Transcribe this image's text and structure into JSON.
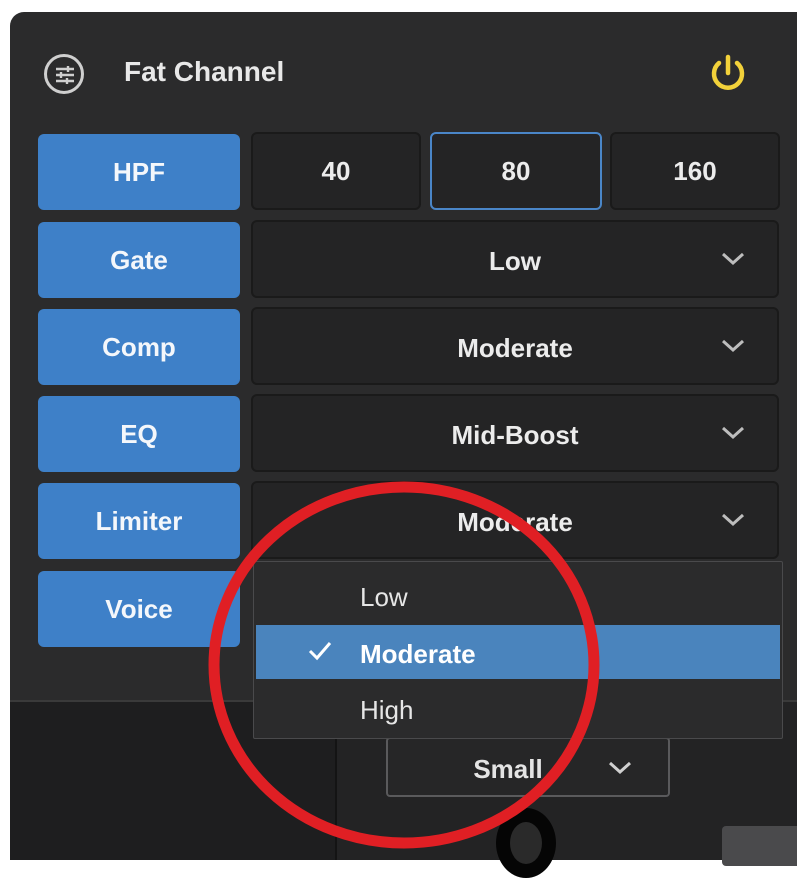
{
  "window": {
    "title": "Fat Channel"
  },
  "icons": {
    "settings": "sliders-icon",
    "power": "power-icon",
    "chevron": "chevron-down-icon",
    "check": "checkmark-icon"
  },
  "colors": {
    "accent_blue": "#3e80c8",
    "power_yellow": "#f2d13a",
    "annotation_red": "#e01f24",
    "menu_selected": "#4a84bd"
  },
  "hpf": {
    "label": "HPF",
    "options": [
      "40",
      "80",
      "160"
    ],
    "selected": "80"
  },
  "rows": {
    "gate": {
      "label": "Gate",
      "value": "Low"
    },
    "comp": {
      "label": "Comp",
      "value": "Moderate"
    },
    "eq": {
      "label": "EQ",
      "value": "Mid-Boost"
    },
    "limiter": {
      "label": "Limiter",
      "value": "Moderate"
    },
    "voice": {
      "label": "Voice"
    }
  },
  "dropdown_menu": {
    "items": [
      "Low",
      "Moderate",
      "High"
    ],
    "selected": "Moderate"
  },
  "size_select": {
    "value": "Small"
  }
}
